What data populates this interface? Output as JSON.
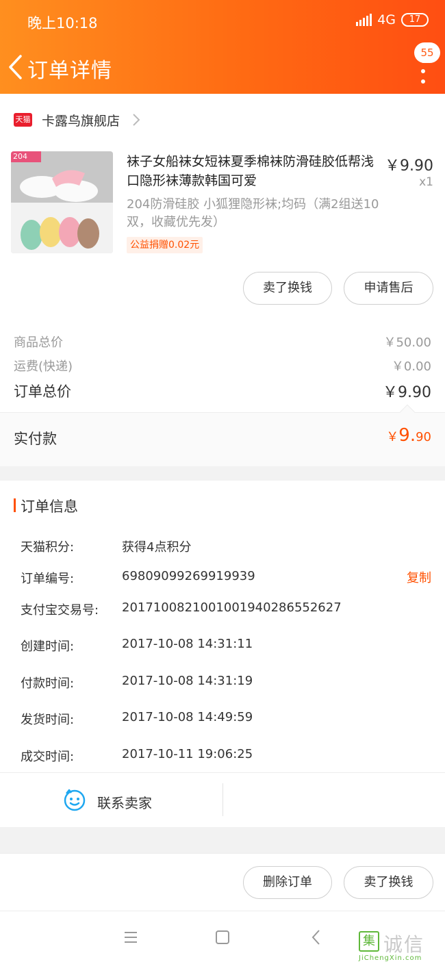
{
  "status_bar": {
    "time": "晚上10:18",
    "network": "4G",
    "battery": "17"
  },
  "header": {
    "title": "订单详情",
    "message_count": "55"
  },
  "shop": {
    "badge": "天猫",
    "name": "卡露鸟旗舰店"
  },
  "product": {
    "image_tag": "204",
    "title": "袜子女船袜女短袜夏季棉袜防滑硅胶低帮浅口隐形袜薄款韩国可爱",
    "price": "￥9.90",
    "quantity": "x1",
    "sku": "204防滑硅胶 小狐狸隐形袜;均码（满2组送10双，收藏优先发）",
    "charity": "公益捐赠0.02元",
    "actions": [
      "卖了换钱",
      "申请售后"
    ]
  },
  "summary": {
    "items_total_label": "商品总价",
    "items_total": "￥50.00",
    "shipping_label": "运费(快递)",
    "shipping": "￥0.00",
    "order_total_label": "订单总价",
    "order_total": "￥9.90",
    "paid_label": "实付款",
    "paid_currency": "￥",
    "paid_int": "9.",
    "paid_dec": "90"
  },
  "order_info": {
    "title": "订单信息",
    "copy_label": "复制",
    "rows": [
      {
        "label": "天猫积分:",
        "value": "获得4点积分"
      },
      {
        "label": "订单编号:",
        "value": "69809099269919939"
      },
      {
        "label": "支付宝交易号:",
        "value": "2017100821001001940286552627"
      },
      {
        "label": "创建时间:",
        "value": "2017-10-08 14:31:11"
      },
      {
        "label": "付款时间:",
        "value": "2017-10-08 14:31:19"
      },
      {
        "label": "发货时间:",
        "value": "2017-10-08 14:49:59"
      },
      {
        "label": "成交时间:",
        "value": "2017-10-11 19:06:25"
      }
    ]
  },
  "contact": {
    "label": "联系卖家"
  },
  "bottom_actions": [
    "删除订单",
    "卖了换钱"
  ],
  "watermark": {
    "mark": "集",
    "text": "诚信",
    "url": "JiChengXin.com"
  },
  "colors": {
    "accent": "#ff5000",
    "header_start": "#ff8f1f",
    "header_end": "#ff4e12",
    "tmall_red": "#e91e2d"
  }
}
